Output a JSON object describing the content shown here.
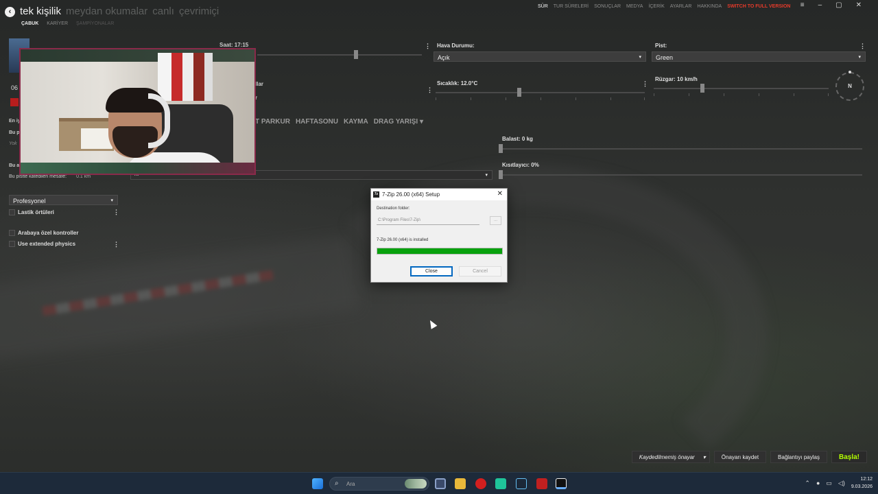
{
  "header": {
    "mode_tabs": [
      "tek kişilik",
      "meydan okumalar",
      "canlı",
      "çevrimiçi"
    ],
    "sub_tabs": [
      "ÇABUK",
      "KARİYER",
      "ŞAMPİYONALAR"
    ],
    "top_nav": [
      "SÜR",
      "TUR SÜRELERİ",
      "SONUÇLAR",
      "MEDYA",
      "İÇERİK",
      "AYARLAR",
      "HAKKINDA"
    ],
    "full_version": "SWITCH TO FULL VERSION",
    "window_controls": [
      "≡",
      "–",
      "▢",
      "✕"
    ]
  },
  "left": {
    "corner_number": "06",
    "time_label": "Saat: 17:15",
    "best_label": "En iy",
    "track_label_1": "Bu p",
    "track_hint": "Yok",
    "track_label_2": "Bu a",
    "track_length_label": "Bu pistte katedilen mesafe:",
    "track_length_value": "0.1 km",
    "difficulty": "Profesyonel",
    "checkboxes": [
      "Lastik örtüleri",
      "Arabaya özel kontroller",
      "Use extended physics"
    ],
    "overflow_text_1": "llar",
    "overflow_text_2": "r",
    "hidden_dropdown_value": "rk"
  },
  "race_tabs": [
    "T PARKUR",
    "HAFTASONU",
    "KAYMA",
    "DRAG YARIŞI ▾"
  ],
  "settings": {
    "weather_label": "Hava Durumu:",
    "weather_value": "Açık",
    "track_label": "Pist:",
    "track_value": "Green",
    "temp_label": "Sıcaklık: 12.0°C",
    "temp_level": 0.4,
    "wind_label": "Rüzgar: 10 km/h",
    "wind_level": 0.28,
    "time_level": 0.6,
    "compass_label": "N",
    "ballast_label": "Balast: 0 kg",
    "restrictor_label": "Kısıtlayıcı: 0%"
  },
  "dialog": {
    "icon": "7z",
    "title": "7-Zip 26.00 (x64) Setup",
    "close_x": "✕",
    "dest_label": "Destination folder:",
    "dest_value": "C:\\Program Files\\7-Zip\\",
    "browse_label": "...",
    "status": "7-Zip 26.00 (x64) is installed",
    "progress": 1.0,
    "close_btn": "Close",
    "cancel_btn": "Cancel"
  },
  "bottom_bar": {
    "preset": "Kaydedilmemiş önayar",
    "save_preset": "Önayarı kaydet",
    "share": "Bağlantıyı paylaş",
    "start": "Başla!"
  },
  "taskbar": {
    "search_placeholder": "Ara",
    "time": "12:12",
    "date": "9.03.2026",
    "tray_icons": [
      "chevron-up-icon",
      "mic-icon",
      "network-icon",
      "volume-icon"
    ]
  },
  "colors": {
    "accent_red": "#e63a2a",
    "start_green": "#b4ff00",
    "progress_green": "#08a10d"
  }
}
